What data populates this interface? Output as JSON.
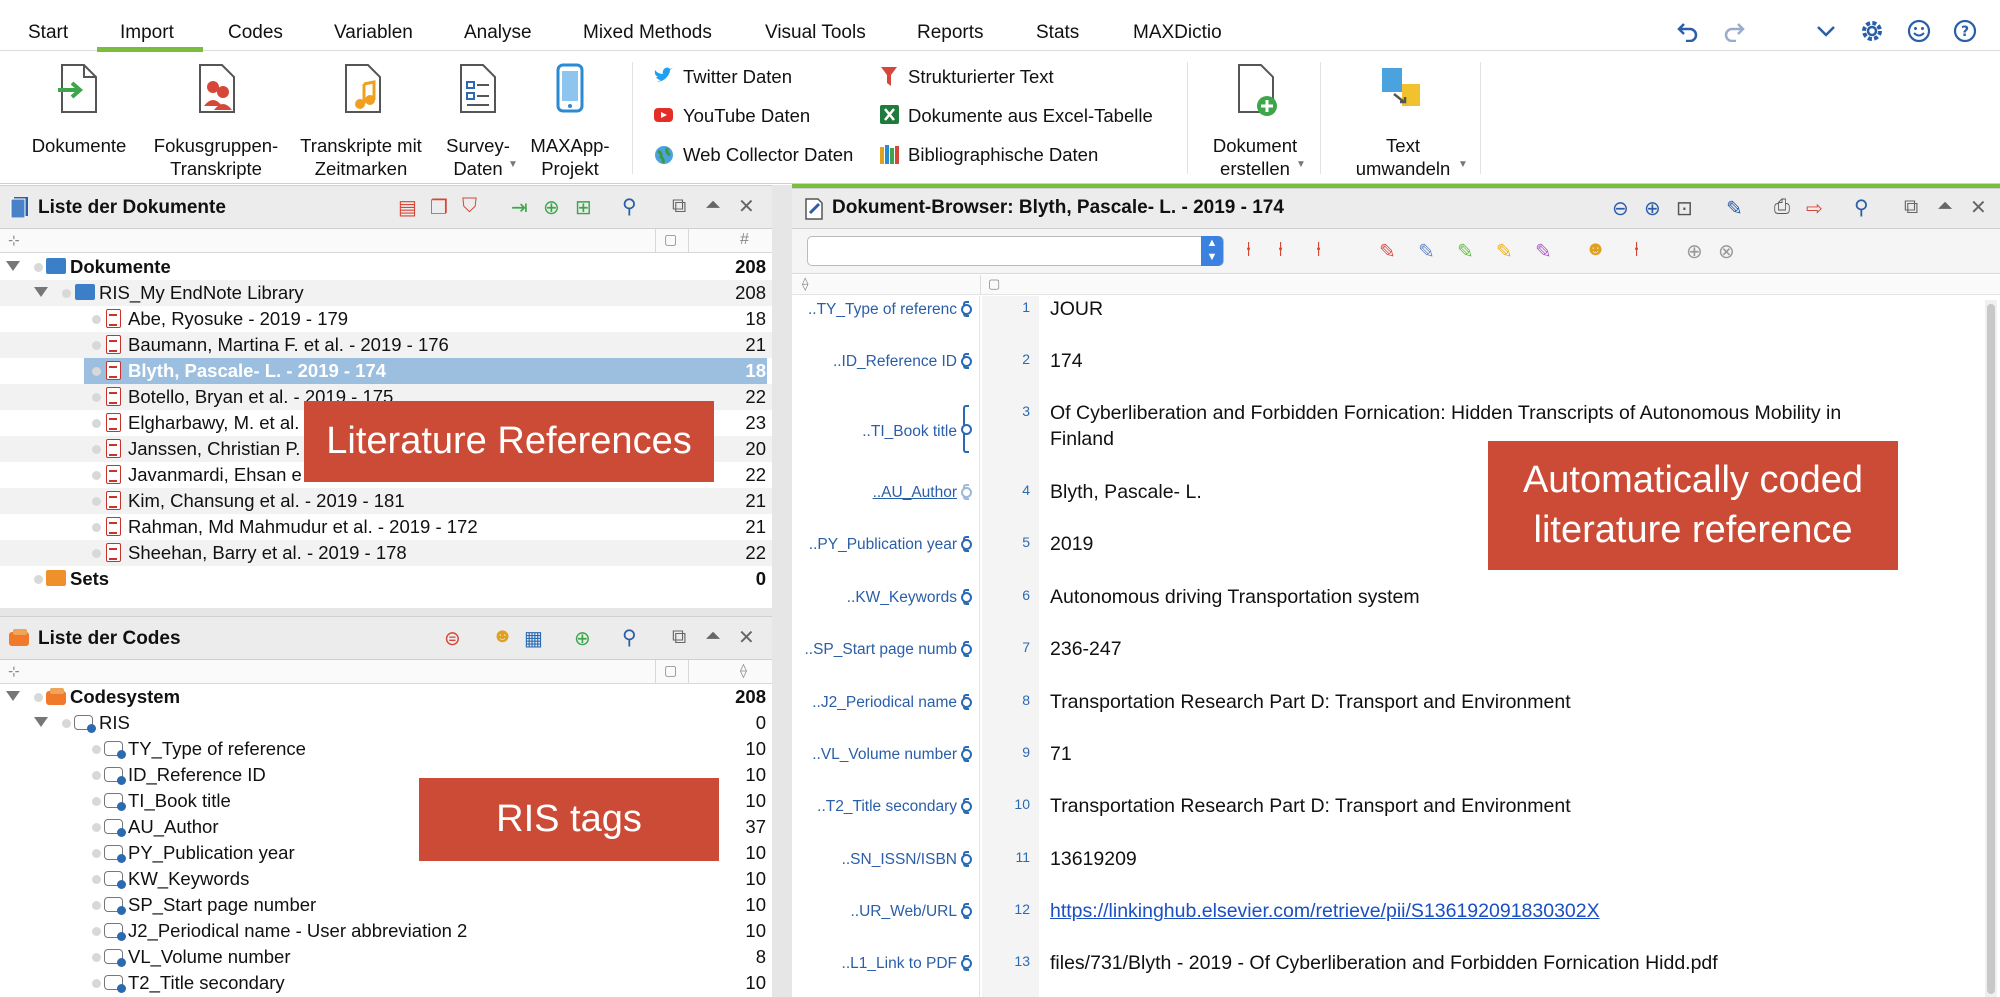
{
  "menu": {
    "items": [
      "Start",
      "Import",
      "Codes",
      "Variablen",
      "Analyse",
      "Mixed Methods",
      "Visual Tools",
      "Reports",
      "Stats",
      "MAXDictio"
    ],
    "active": "Import"
  },
  "ribbon": {
    "dokumente": "Dokumente",
    "fokus1": "Fokusgruppen-",
    "fokus2": "Transkripte",
    "transk1": "Transkripte mit",
    "transk2": "Zeitmarken",
    "survey1": "Survey-",
    "survey2": "Daten",
    "maxapp1": "MAXApp-",
    "maxapp2": "Projekt",
    "twitter": "Twitter Daten",
    "youtube": "YouTube Daten",
    "webcollector": "Web Collector Daten",
    "strukt": "Strukturierter Text",
    "excel": "Dokumente aus Excel-Tabelle",
    "biblio": "Bibliographische Daten",
    "dokerst1": "Dokument",
    "dokerst2": "erstellen",
    "text1": "Text",
    "text2": "umwandeln"
  },
  "docs_panel": {
    "title": "Liste der Dokumente",
    "col_hash": "#",
    "root": {
      "label": "Dokumente",
      "count": "208"
    },
    "group": {
      "label": "RIS_My EndNote Library",
      "count": "208"
    },
    "items": [
      {
        "label": "Abe, Ryosuke - 2019 - 179",
        "count": "18"
      },
      {
        "label": "Baumann, Martina F. et al. - 2019 - 176",
        "count": "21"
      },
      {
        "label": "Blyth, Pascale- L. - 2019 - 174",
        "count": "18"
      },
      {
        "label": "Botello, Bryan et al. - 2019 - 175",
        "count": "22"
      },
      {
        "label": "Elgharbawy, M. et al.",
        "count": "23"
      },
      {
        "label": "Janssen, Christian P.",
        "count": "20"
      },
      {
        "label": "Javanmardi, Ehsan e",
        "count": "22"
      },
      {
        "label": "Kim, Chansung et al. - 2019 - 181",
        "count": "21"
      },
      {
        "label": "Rahman, Md Mahmudur et al. - 2019 - 172",
        "count": "21"
      },
      {
        "label": "Sheehan, Barry et al. - 2019 - 178",
        "count": "22"
      }
    ],
    "sets": {
      "label": "Sets",
      "count": "0"
    }
  },
  "codes_panel": {
    "title": "Liste der Codes",
    "root": {
      "label": "Codesystem",
      "count": "208"
    },
    "group": {
      "label": "RIS",
      "count": "0"
    },
    "items": [
      {
        "label": "TY_Type of reference",
        "count": "10"
      },
      {
        "label": "ID_Reference ID",
        "count": "10"
      },
      {
        "label": "TI_Book title",
        "count": "10"
      },
      {
        "label": "AU_Author",
        "count": "37"
      },
      {
        "label": "PY_Publication year",
        "count": "10"
      },
      {
        "label": "KW_Keywords",
        "count": "10"
      },
      {
        "label": "SP_Start page number",
        "count": "10"
      },
      {
        "label": "J2_Periodical name - User abbreviation 2",
        "count": "10"
      },
      {
        "label": "VL_Volume number",
        "count": "8"
      },
      {
        "label": "T2_Title secondary",
        "count": "10"
      }
    ]
  },
  "browser": {
    "title": "Dokument-Browser: Blyth, Pascale- L. - 2019 - 174",
    "lines": [
      {
        "num": "1",
        "code": "..TY_Type of referenc",
        "text": "JOUR"
      },
      {
        "num": "2",
        "code": "..ID_Reference ID",
        "text": "174"
      },
      {
        "num": "3",
        "code": "..TI_Book title",
        "text": "Of Cyberliberation and Forbidden Fornication: Hidden Transcripts of Autonomous Mobility in",
        "text2": "Finland"
      },
      {
        "num": "4",
        "code": "..AU_Author",
        "text": "Blyth, Pascale- L."
      },
      {
        "num": "5",
        "code": "..PY_Publication year",
        "text": "2019"
      },
      {
        "num": "6",
        "code": "..KW_Keywords",
        "text": "Autonomous driving Transportation system"
      },
      {
        "num": "7",
        "code": "..SP_Start page numb",
        "text": "236-247"
      },
      {
        "num": "8",
        "code": "..J2_Periodical name",
        "text": "Transportation Research Part D: Transport and Environment"
      },
      {
        "num": "9",
        "code": "..VL_Volume number",
        "text": "71"
      },
      {
        "num": "10",
        "code": "..T2_Title secondary",
        "text": "Transportation Research Part D: Transport and Environment"
      },
      {
        "num": "11",
        "code": "..SN_ISSN/ISBN",
        "text": "13619209"
      },
      {
        "num": "12",
        "code": "..UR_Web/URL",
        "text": "https://linkinghub.elsevier.com/retrieve/pii/S136192091830302X"
      },
      {
        "num": "13",
        "code": "..L1_Link to PDF",
        "text": "files/731/Blyth - 2019 - Of Cyberliberation and Forbidden Fornication Hidd.pdf"
      }
    ]
  },
  "callouts": {
    "literature": "Literature References",
    "ris": "RIS tags",
    "auto1": "Automatically coded",
    "auto2": "literature reference"
  },
  "colors": {
    "accent_green": "#7bbd3f",
    "callout": "#cc4b36",
    "selection": "#9cbfe0",
    "code_blue": "#2a6ab3"
  }
}
